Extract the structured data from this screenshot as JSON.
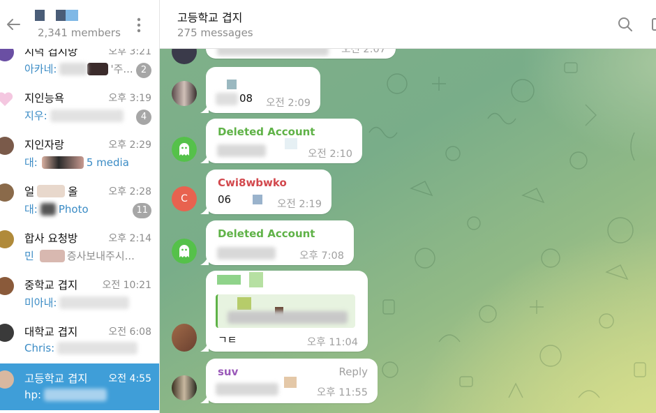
{
  "sidebar": {
    "members": "2,341 members",
    "chats": [
      {
        "name": "시덕 겹시방",
        "time": "오후 3:21",
        "sender": "아카네:",
        "text": "'주...",
        "badge": "2"
      },
      {
        "name": "지인능욕",
        "time": "오후 3:19",
        "sender": "지우:",
        "text": "",
        "badge": "4"
      },
      {
        "name": "지인자랑",
        "time": "오후 2:29",
        "sender": "대:",
        "media": "5 media"
      },
      {
        "name": "얼",
        "name_suffix": "올",
        "time": "오후 2:28",
        "sender": "대:",
        "media": "Photo",
        "badge": "11"
      },
      {
        "name": "합사 요청방",
        "time": "오후 2:14",
        "sender": "민",
        "text": "증사보내주시..."
      },
      {
        "name": "중학교 겹지",
        "time": "오전 10:21",
        "sender": "미아내:",
        "text": ""
      },
      {
        "name": "대학교 겹지",
        "time": "오전 6:08",
        "sender": "Chris:",
        "text": ""
      },
      {
        "name": "고등학교 겹지",
        "time": "오전 4:55",
        "sender": "hp:",
        "text": ""
      }
    ]
  },
  "header": {
    "title": "고등학교 겹지",
    "subtitle": "275 messages"
  },
  "messages": [
    {
      "time": "오전 2:07"
    },
    {
      "text": "08",
      "time": "오전 2:09"
    },
    {
      "sender": "Deleted Account",
      "time": "오전 2:10"
    },
    {
      "sender": "Cwi8wbwko",
      "text": "06",
      "time": "오전 2:19",
      "avatar_letter": "C"
    },
    {
      "sender": "Deleted Account",
      "time": "오후 7:08"
    },
    {
      "text": "ㄱㅌ",
      "time": "오후 11:04"
    },
    {
      "sender": "suv",
      "reply": "Reply",
      "time": "오후 11:55"
    }
  ],
  "colors": {
    "accent": "#3f9ed8",
    "deleted_sender": "#5fb247",
    "cwi_sender": "#d2484d",
    "suv_sender": "#9a59b9",
    "ghost_avatar": "#55c14a",
    "c_avatar": "#e8624f"
  },
  "icons": {
    "back": "arrow-left-icon",
    "more": "dots-vertical-icon",
    "search": "search-icon",
    "ghost": "ghost-icon"
  }
}
